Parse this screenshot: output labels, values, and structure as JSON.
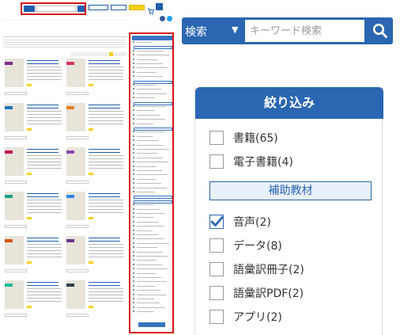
{
  "search": {
    "category": "検索",
    "placeholder": "キーワード検索"
  },
  "filter": {
    "title": "絞り込み",
    "options_top": [
      {
        "label": "書籍(65)",
        "checked": false
      },
      {
        "label": "電子書籍(4)",
        "checked": false
      }
    ],
    "aux_label": "補助教材",
    "options_aux": [
      {
        "label": "音声(2)",
        "checked": true
      },
      {
        "label": "データ(8)",
        "checked": false
      },
      {
        "label": "語彙訳冊子(2)",
        "checked": false
      },
      {
        "label": "語彙訳PDF(2)",
        "checked": false
      },
      {
        "label": "アプリ(2)",
        "checked": false
      }
    ]
  },
  "colors": {
    "brand_blue": "#2a66b1",
    "highlight_red": "#d7141a",
    "check_blue": "#2a66b1"
  },
  "icons": [
    "search-icon",
    "chevron-down-icon",
    "check-icon",
    "facebook-icon",
    "twitter-icon",
    "cart-icon",
    "menu-icon"
  ]
}
